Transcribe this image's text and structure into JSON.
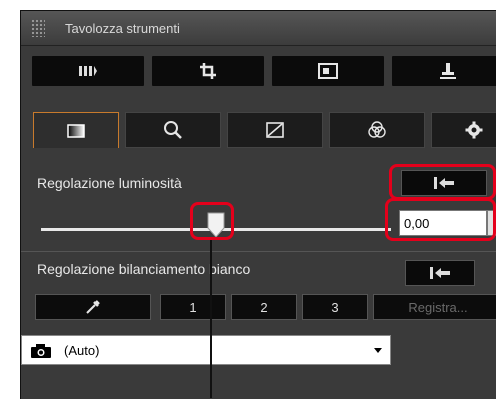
{
  "window": {
    "title": "Tavolozza strumenti"
  },
  "toolbar": {
    "items": [
      "tool-1",
      "crop-icon",
      "image-icon",
      "stamp-icon"
    ]
  },
  "tabs": [
    {
      "name": "tab-brightness",
      "active": true
    },
    {
      "name": "tab-zoom"
    },
    {
      "name": "tab-curve"
    },
    {
      "name": "tab-color"
    },
    {
      "name": "tab-settings"
    }
  ],
  "brightness": {
    "label": "Regolazione luminosità",
    "value": "0,00",
    "slider_fraction": 0.5
  },
  "white_balance": {
    "label": "Regolazione bilanciamento bianco",
    "buttons": [
      "1",
      "2",
      "3",
      "Registra..."
    ],
    "selected": "(Auto)"
  },
  "colors": {
    "accent": "#c87a2c",
    "highlight": "#e4001b"
  }
}
